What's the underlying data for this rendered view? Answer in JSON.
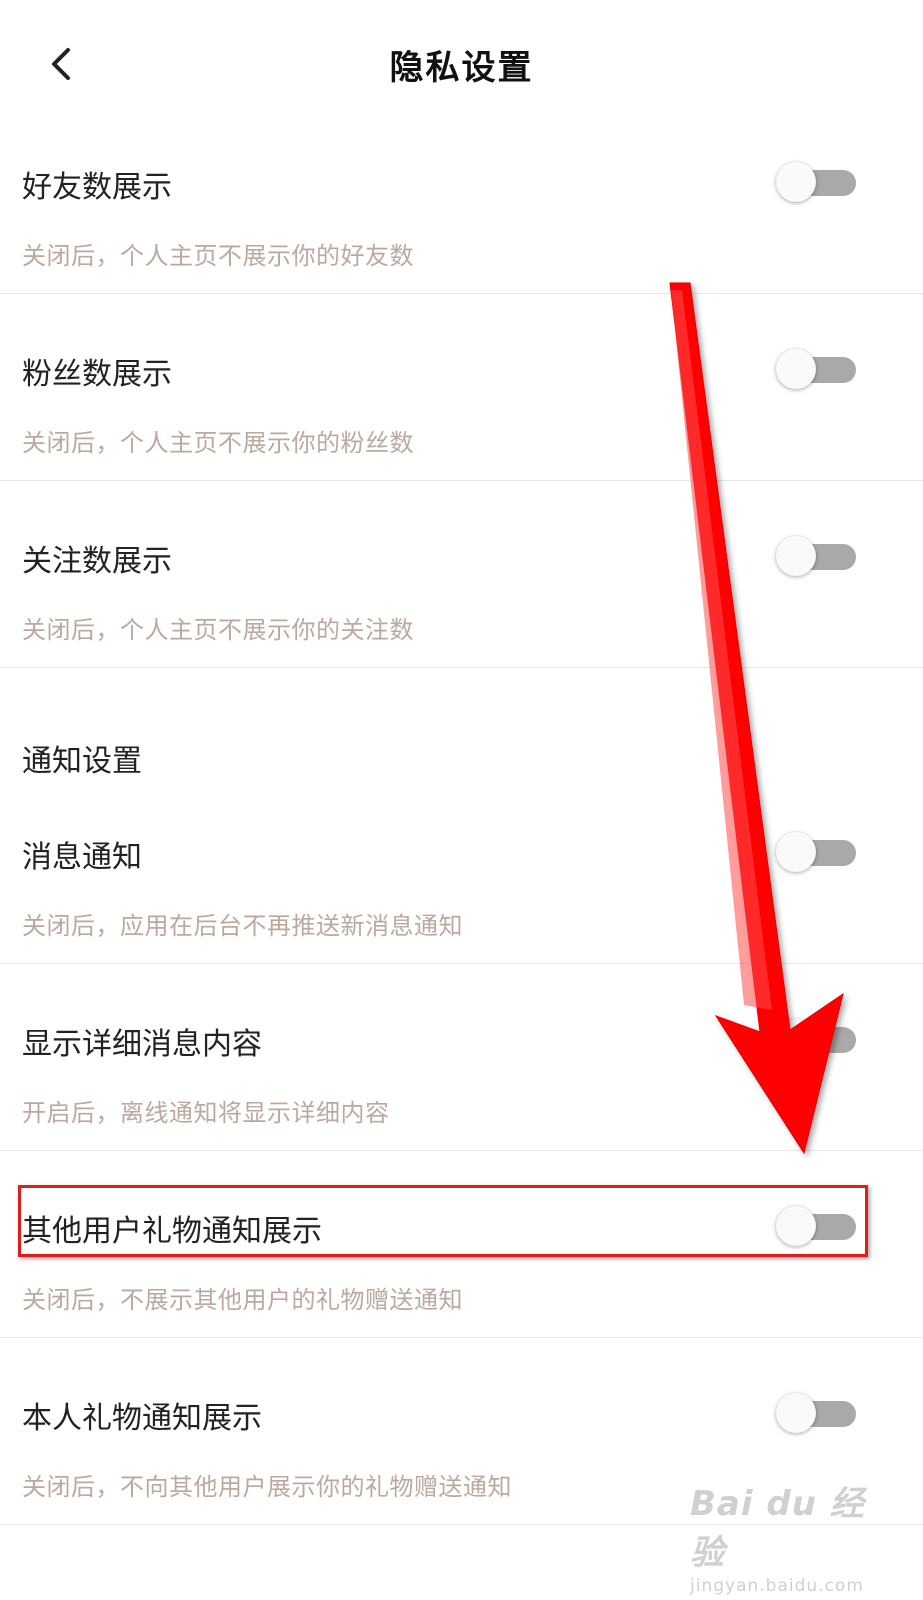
{
  "header": {
    "title": "隐私设置",
    "back_icon": "chevron-left-icon"
  },
  "settings": [
    {
      "title": "好友数展示",
      "desc": "关闭后，个人主页不展示你的好友数",
      "enabled": false
    },
    {
      "title": "粉丝数展示",
      "desc": "关闭后，个人主页不展示你的粉丝数",
      "enabled": false
    },
    {
      "title": "关注数展示",
      "desc": "关闭后，个人主页不展示你的关注数",
      "enabled": false
    }
  ],
  "notification_section": {
    "header": "通知设置",
    "items": [
      {
        "title": "消息通知",
        "desc": "关闭后，应用在后台不再推送新消息通知",
        "enabled": false
      },
      {
        "title": "显示详细消息内容",
        "desc": "开启后，离线通知将显示详细内容",
        "enabled": false
      },
      {
        "title": "其他用户礼物通知展示",
        "desc": "关闭后，不展示其他用户的礼物赠送通知",
        "enabled": false,
        "highlighted": true
      },
      {
        "title": "本人礼物通知展示",
        "desc": "关闭后，不向其他用户展示你的礼物赠送通知",
        "enabled": false
      }
    ]
  },
  "annotation": {
    "arrow_color": "#ff0000",
    "highlight_color": "#e11c1c"
  },
  "watermark": {
    "logo": "Bai du 经验",
    "url": "jingyan.baidu.com"
  }
}
